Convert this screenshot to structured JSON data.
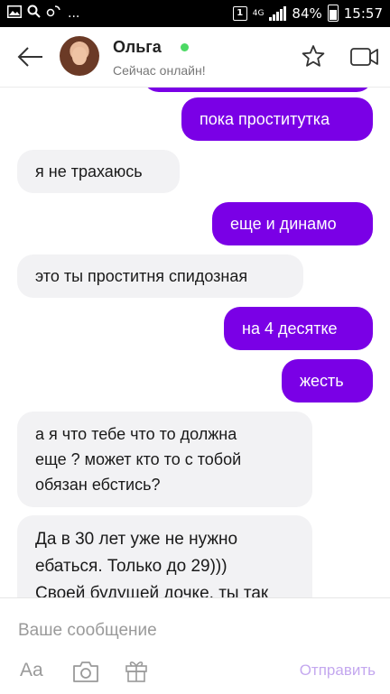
{
  "status_bar": {
    "left_icons": [
      "image-icon",
      "search-icon",
      "temperature-icon",
      "more-notifications-icon"
    ],
    "more_text": "...",
    "sim_label": "1",
    "network": "4G",
    "battery_percent": "84%",
    "time": "15:57"
  },
  "header": {
    "contact_name": "Ольга",
    "contact_status": "Сейчас онлайн!",
    "online_color": "#4cd964"
  },
  "messages": [
    {
      "dir": "out",
      "lines": [
        "пока проститутка"
      ]
    },
    {
      "dir": "in",
      "lines": [
        "я не трахаюсь"
      ]
    },
    {
      "dir": "out",
      "lines": [
        "еще и динамо"
      ]
    },
    {
      "dir": "in",
      "lines": [
        "это ты проститня спидозная"
      ]
    },
    {
      "dir": "out",
      "lines": [
        "на 4 десятке"
      ]
    },
    {
      "dir": "out",
      "lines": [
        "жесть"
      ]
    },
    {
      "dir": "in",
      "lines": [
        "а я что тебе что то должна",
        "еще ? может кто то с тобой",
        "обязан ебстись?"
      ]
    },
    {
      "dir": "in",
      "lines": [
        "Да в 30 лет уже не нужно",
        "ебаться. Только до 29)))",
        "Своей будущей дочке, ты так"
      ]
    }
  ],
  "composer": {
    "placeholder": "Ваше сообщение",
    "format_label": "Aa",
    "send_label": "Отправить"
  },
  "colors": {
    "outgoing_bubble": "#7a00e6",
    "incoming_bubble": "#f2f2f4",
    "send_disabled": "#c4a8ef"
  }
}
